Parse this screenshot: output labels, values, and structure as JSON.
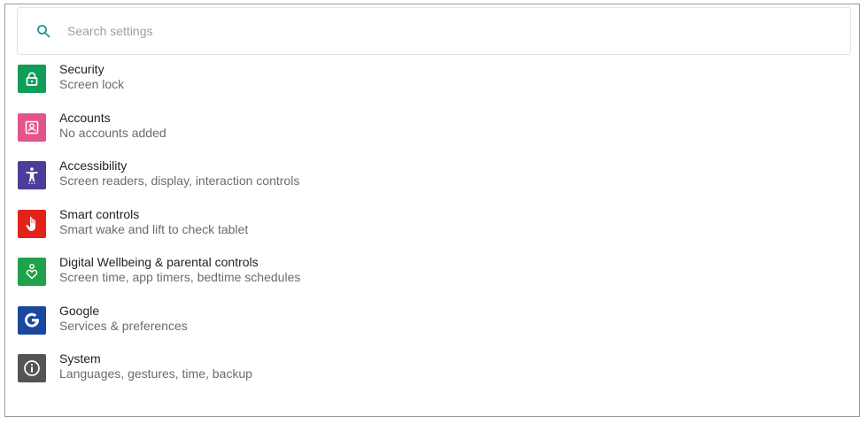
{
  "search": {
    "placeholder": "Search settings"
  },
  "items": [
    {
      "title": "Security",
      "subtitle": "Screen lock",
      "color": "#0f9d58",
      "icon": "lock-icon"
    },
    {
      "title": "Accounts",
      "subtitle": "No accounts added",
      "color": "#e5538d",
      "icon": "account-box-icon"
    },
    {
      "title": "Accessibility",
      "subtitle": "Screen readers, display, interaction controls",
      "color": "#4b3d99",
      "icon": "accessibility-icon"
    },
    {
      "title": "Smart controls",
      "subtitle": "Smart wake and lift to check tablet",
      "color": "#e2231a",
      "icon": "hand-icon"
    },
    {
      "title": "Digital Wellbeing & parental controls",
      "subtitle": "Screen time, app timers, bedtime schedules",
      "color": "#1fa24a",
      "icon": "wellbeing-icon"
    },
    {
      "title": "Google",
      "subtitle": "Services & preferences",
      "color": "#1a47a0",
      "icon": "google-icon"
    },
    {
      "title": "System",
      "subtitle": "Languages, gestures, time, backup",
      "color": "#545454",
      "icon": "info-icon"
    }
  ]
}
